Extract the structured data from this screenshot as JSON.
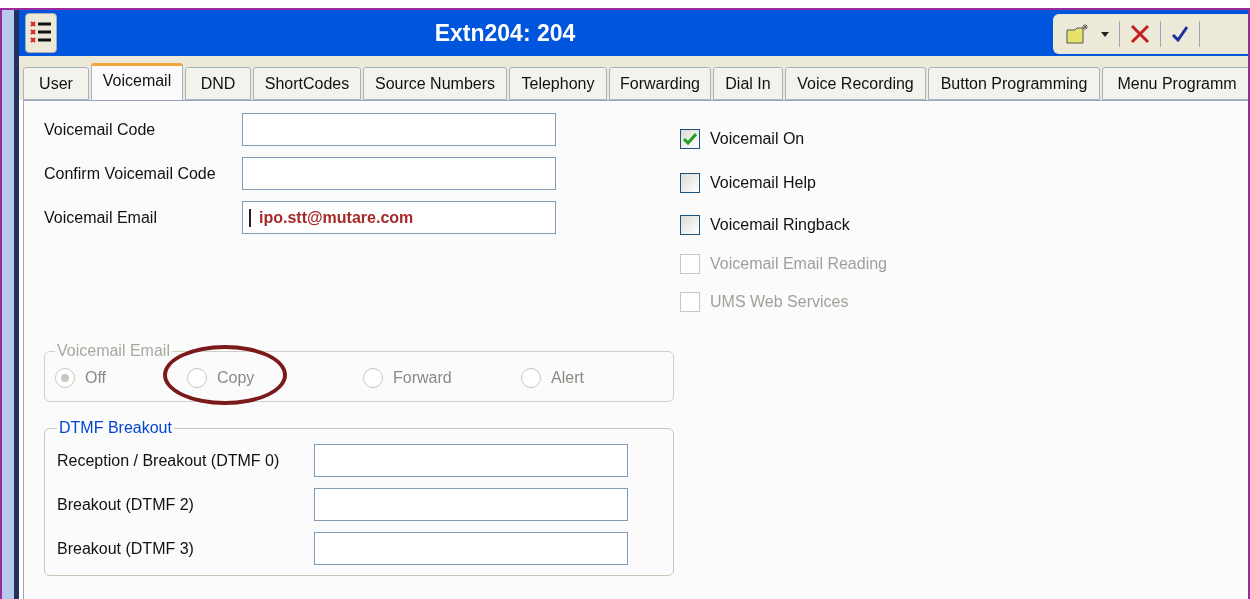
{
  "window": {
    "title": "Extn204: 204"
  },
  "tabs": [
    {
      "label": "User",
      "selected": false
    },
    {
      "label": "Voicemail",
      "selected": true
    },
    {
      "label": "DND",
      "selected": false
    },
    {
      "label": "ShortCodes",
      "selected": false
    },
    {
      "label": "Source Numbers",
      "selected": false
    },
    {
      "label": "Telephony",
      "selected": false
    },
    {
      "label": "Forwarding",
      "selected": false
    },
    {
      "label": "Dial In",
      "selected": false
    },
    {
      "label": "Voice Recording",
      "selected": false
    },
    {
      "label": "Button Programming",
      "selected": false
    },
    {
      "label": "Menu Programm",
      "selected": false
    }
  ],
  "fields": [
    {
      "label": "Voicemail Code"
    },
    {
      "label": "Confirm Voicemail Code"
    },
    {
      "label": "Voicemail Email",
      "value": "ipo.stt@mutare.com",
      "focused": true
    }
  ],
  "checkboxes": [
    {
      "label": "Voicemail On",
      "checked": true,
      "disabled": false
    },
    {
      "label": "Voicemail Help",
      "checked": false,
      "disabled": false
    },
    {
      "label": "Voicemail Ringback",
      "checked": false,
      "disabled": false
    },
    {
      "label": "Voicemail Email Reading",
      "checked": false,
      "disabled": true
    },
    {
      "label": "UMS Web Services",
      "checked": false,
      "disabled": true
    }
  ],
  "voicemail_email_group": {
    "legend": "Voicemail Email",
    "disabled": true,
    "options": [
      {
        "label": "Off",
        "selected": true
      },
      {
        "label": "Copy",
        "selected": false,
        "circled": true
      },
      {
        "label": "Forward",
        "selected": false
      },
      {
        "label": "Alert",
        "selected": false
      }
    ]
  },
  "dtmf_breakout": {
    "legend": "DTMF Breakout",
    "disabled": false,
    "fields": [
      {
        "label": "Reception / Breakout (DTMF 0)"
      },
      {
        "label": "Breakout (DTMF 2)"
      },
      {
        "label": "Breakout (DTMF 3)"
      }
    ]
  }
}
